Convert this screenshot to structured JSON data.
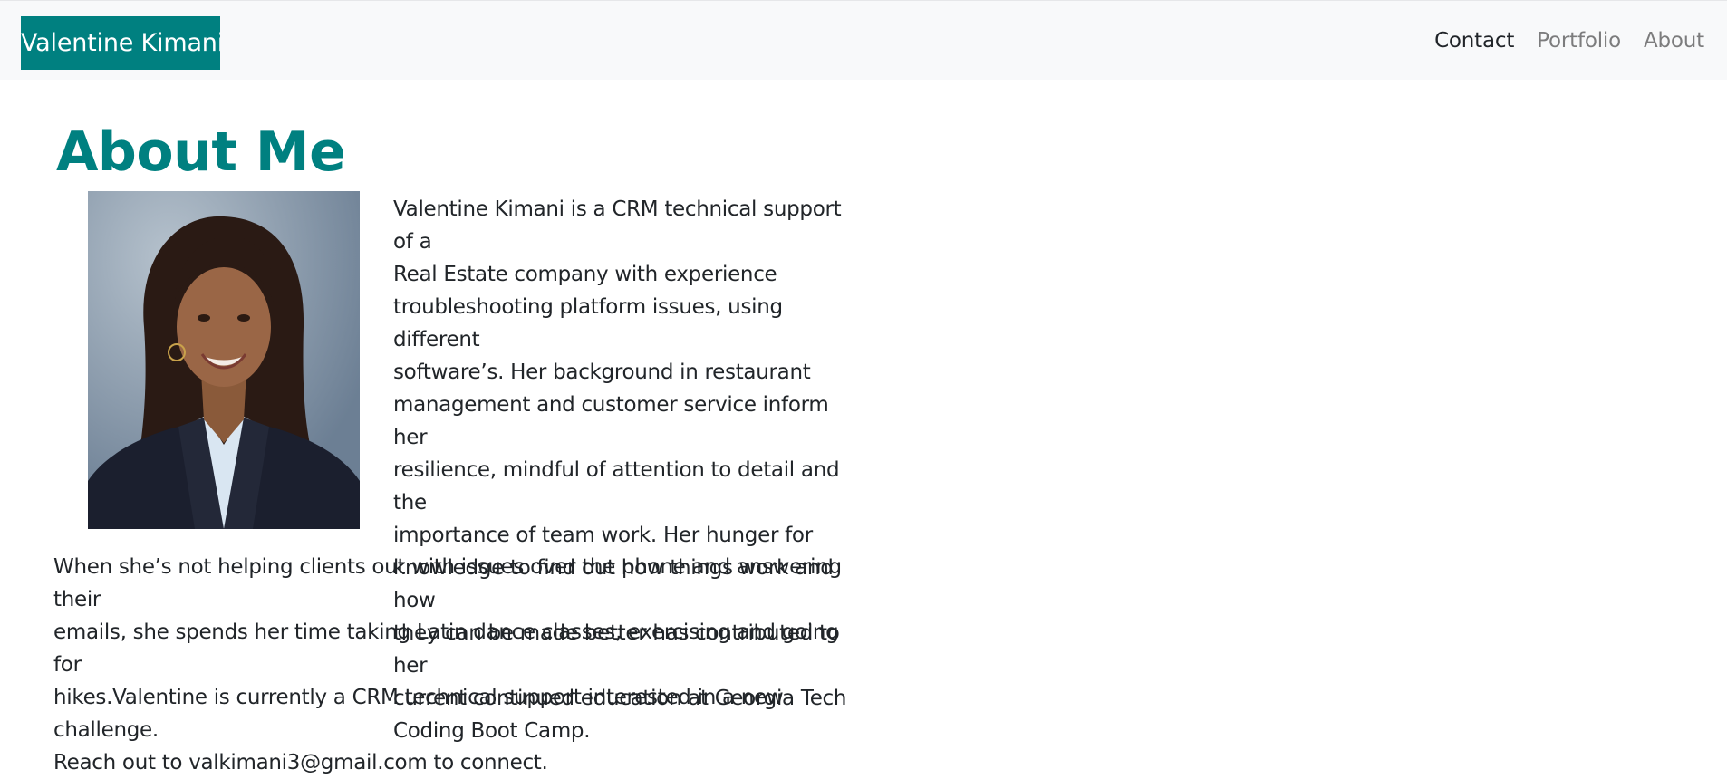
{
  "navbar": {
    "brand": "Valentine Kimani",
    "links": [
      {
        "label": "Contact",
        "active": true
      },
      {
        "label": "Portfolio",
        "active": false
      },
      {
        "label": "About",
        "active": false
      }
    ]
  },
  "main": {
    "title": "About Me",
    "bio_lines": [
      "Valentine Kimani is a CRM technical support of a",
      "Real Estate company with experience",
      "troubleshooting platform issues, using different",
      "software’s. Her background in restaurant",
      "management and customer service inform her",
      "resilience, mindful of attention to detail and the",
      "importance of team work. Her hunger for",
      "knowledge to find out how things work and how",
      "they can be made better has contributed to her",
      "current continued education at Georgia Tech",
      "Coding Boot Camp."
    ],
    "bio_cont_lines": [
      "When she’s not helping clients out with issues over the phone and answering their",
      "emails, she spends her time taking Latin dance classes, exercising and going for",
      "hikes.Valentine is currently a CRM technical support interested in a new challenge.",
      "Reach out to valkimani3@gmail.com to connect."
    ]
  },
  "colors": {
    "brand_bg": "#008080",
    "title": "#008080",
    "navbar_bg": "#f8f9fa"
  }
}
